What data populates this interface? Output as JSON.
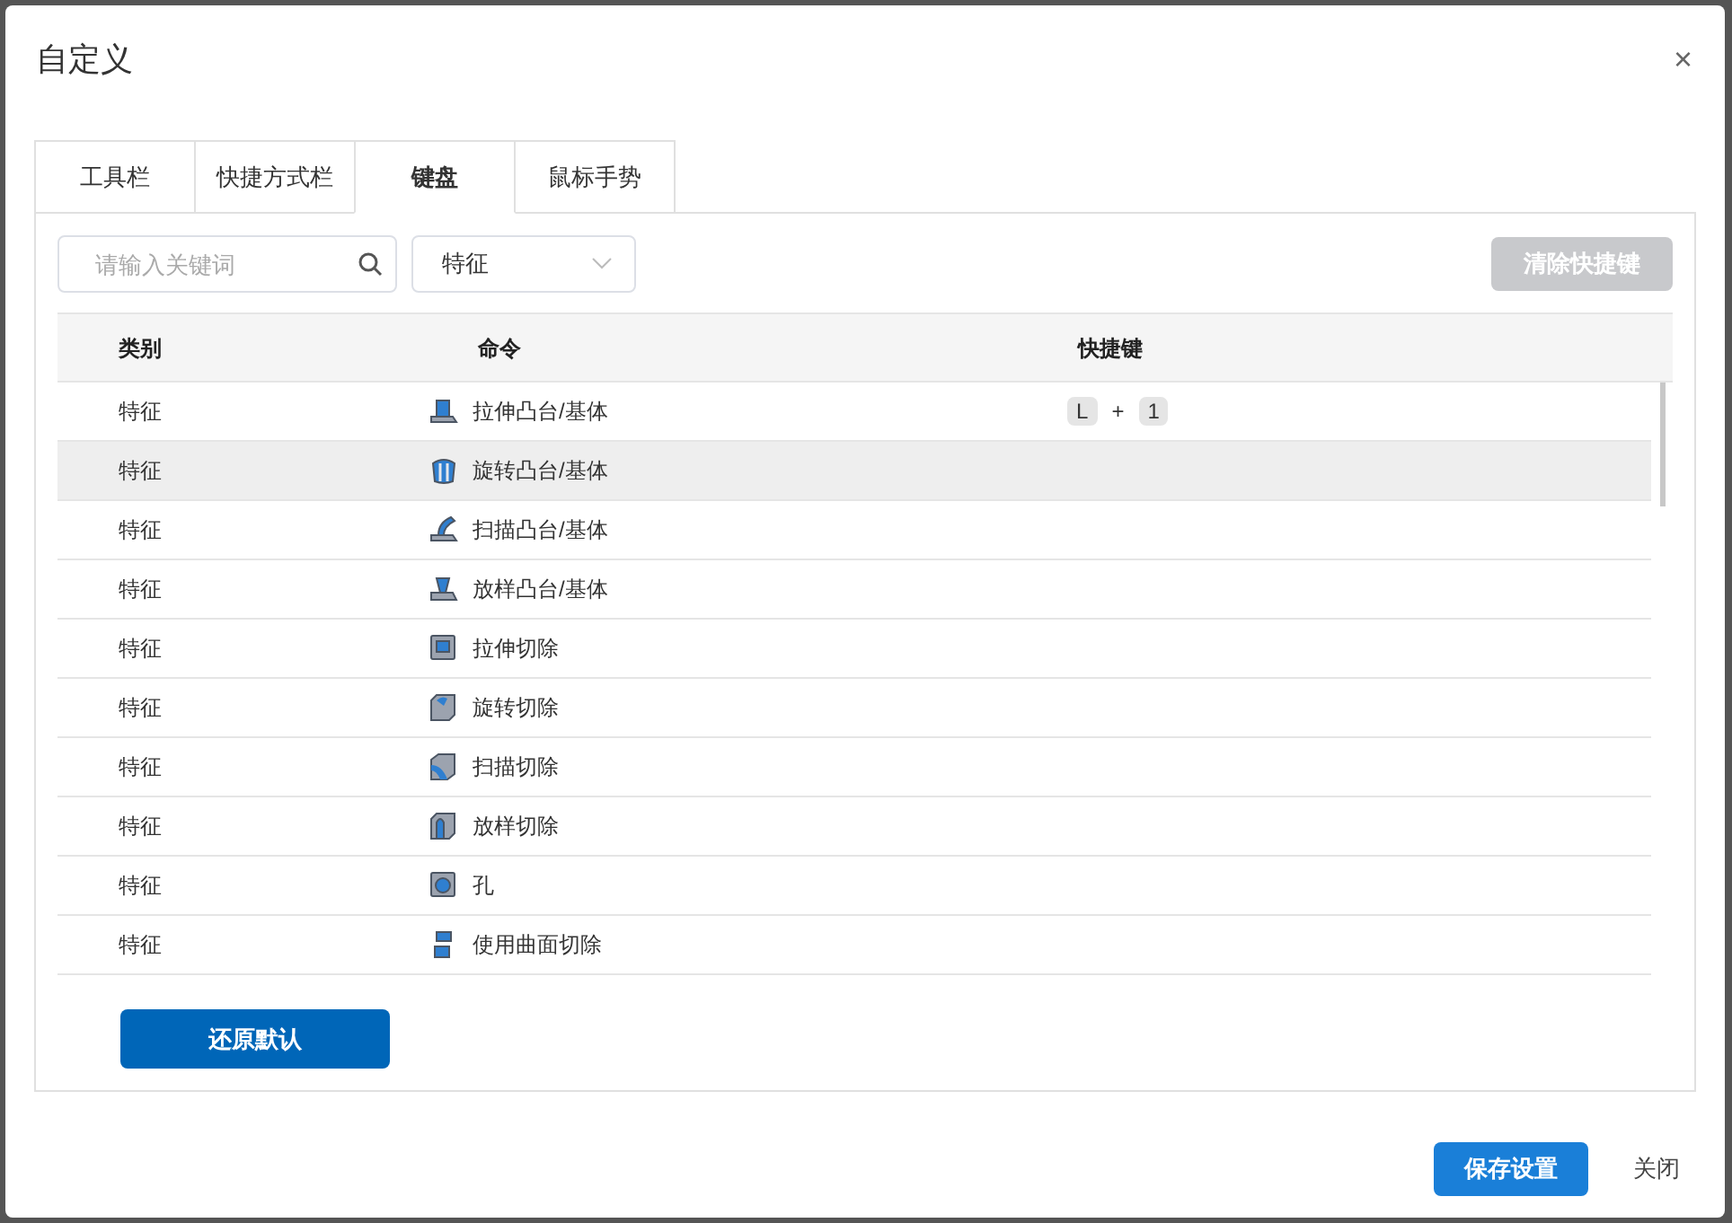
{
  "dialog": {
    "title": "自定义",
    "close": "×"
  },
  "tabs": [
    {
      "label": "工具栏",
      "selected": false
    },
    {
      "label": "快捷方式栏",
      "selected": false
    },
    {
      "label": "键盘",
      "selected": true
    },
    {
      "label": "鼠标手势",
      "selected": false
    }
  ],
  "search": {
    "placeholder": "请输入关键词"
  },
  "category_select": {
    "value": "特征"
  },
  "clear_button": {
    "label": "清除快捷键",
    "disabled": true
  },
  "table": {
    "columns": [
      "类别",
      "命令",
      "快捷键"
    ],
    "rows": [
      {
        "category": "特征",
        "command": "拉伸凸台/基体",
        "kind": "extrude-boss",
        "selected": false,
        "shortcut": {
          "keys": [
            "L",
            "1"
          ],
          "joiner": "+"
        }
      },
      {
        "category": "特征",
        "command": "旋转凸台/基体",
        "kind": "revolve-boss",
        "selected": true
      },
      {
        "category": "特征",
        "command": "扫描凸台/基体",
        "kind": "sweep-boss",
        "selected": false
      },
      {
        "category": "特征",
        "command": "放样凸台/基体",
        "kind": "loft-boss",
        "selected": false
      },
      {
        "category": "特征",
        "command": "拉伸切除",
        "kind": "extrude-cut",
        "selected": false
      },
      {
        "category": "特征",
        "command": "旋转切除",
        "kind": "revolve-cut",
        "selected": false
      },
      {
        "category": "特征",
        "command": "扫描切除",
        "kind": "sweep-cut",
        "selected": false
      },
      {
        "category": "特征",
        "command": "放样切除",
        "kind": "loft-cut",
        "selected": false
      },
      {
        "category": "特征",
        "command": "孔",
        "kind": "hole",
        "selected": false
      },
      {
        "category": "特征",
        "command": "使用曲面切除",
        "kind": "surface-cut",
        "selected": false
      }
    ]
  },
  "restore_button": {
    "label": "还原默认"
  },
  "footer": {
    "save": "保存设置",
    "close": "关闭"
  }
}
